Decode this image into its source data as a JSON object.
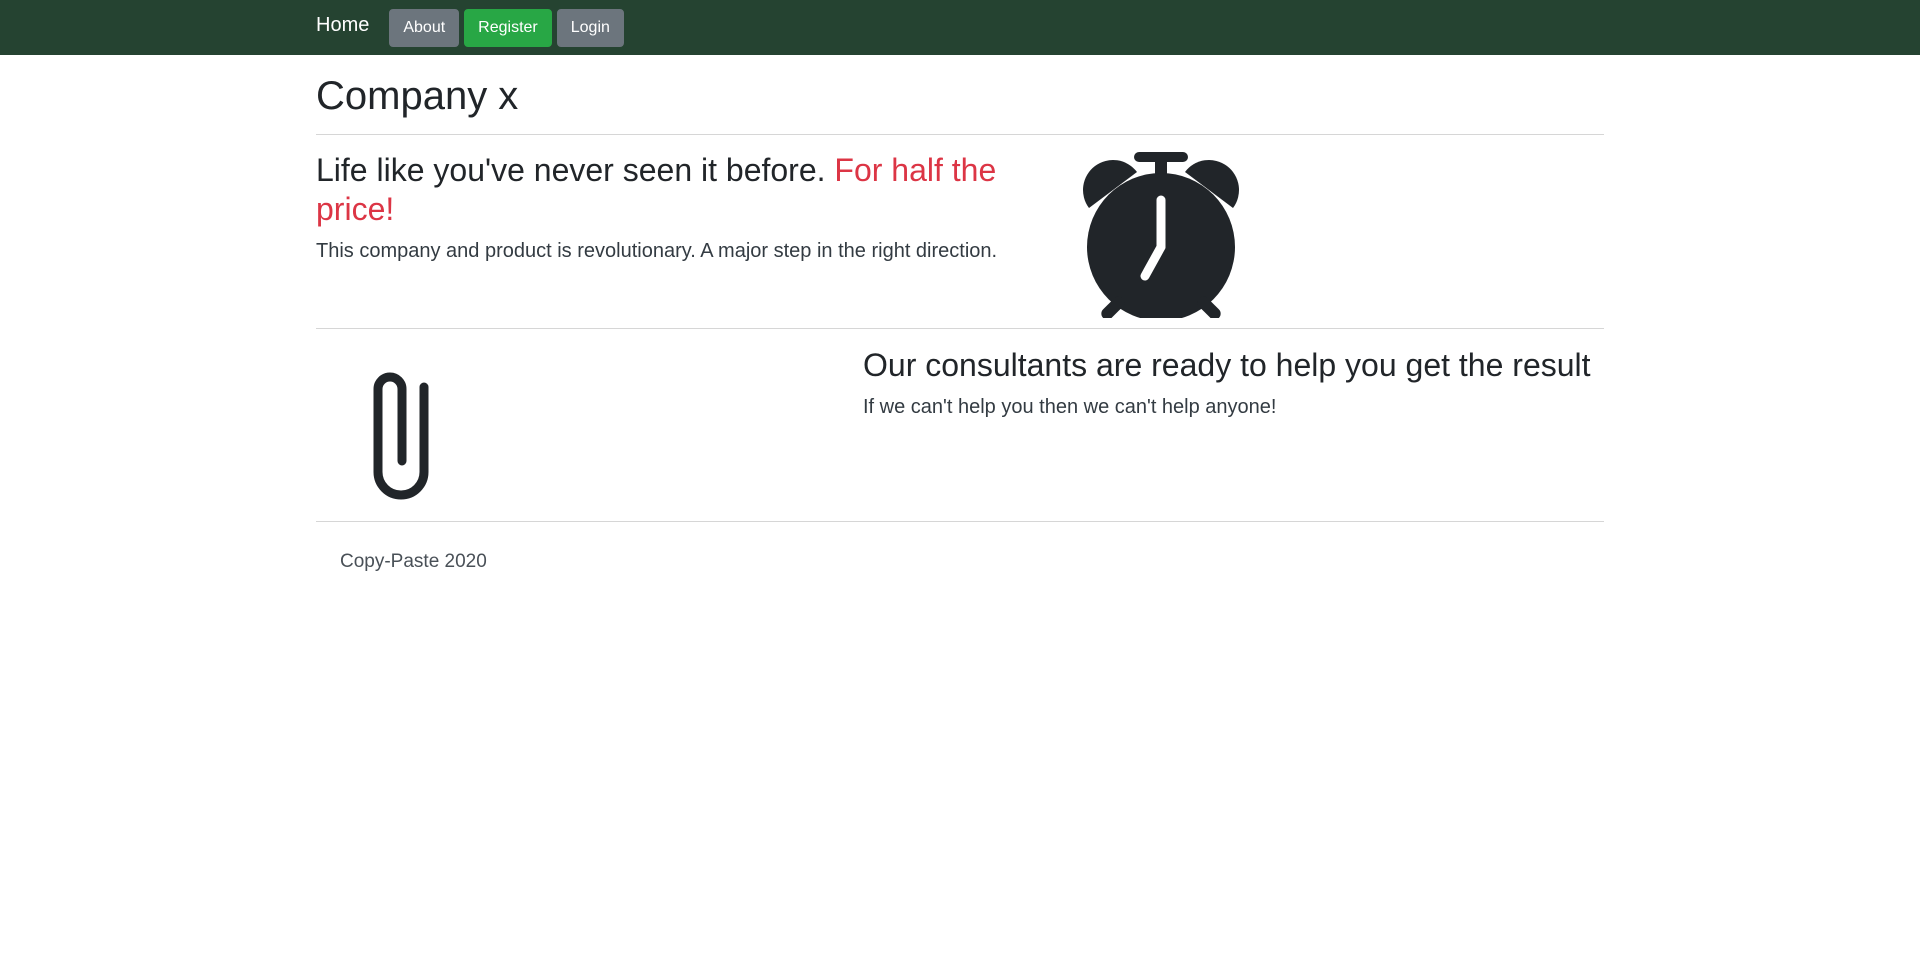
{
  "nav": {
    "brand": "Home",
    "buttons": [
      {
        "label": "About",
        "color": "#6c757d"
      },
      {
        "label": "Register",
        "color": "#28a745"
      },
      {
        "label": "Login",
        "color": "#6c757d"
      }
    ],
    "background": "#254331"
  },
  "page": {
    "title": "Company x"
  },
  "section1": {
    "headline": "Life like you've never seen it before.",
    "highlight": "For half the price!",
    "highlight_color": "#dc3545",
    "lead": "This company and product is revolutionary. A major step in the right direction.",
    "icon": "alarm-clock-icon"
  },
  "section2": {
    "icon": "paperclip-icon",
    "headline": "Our consultants are ready to help you get the result",
    "lead": "If we can't help you then we can't help anyone!"
  },
  "footer": {
    "text": "Copy-Paste 2020"
  }
}
